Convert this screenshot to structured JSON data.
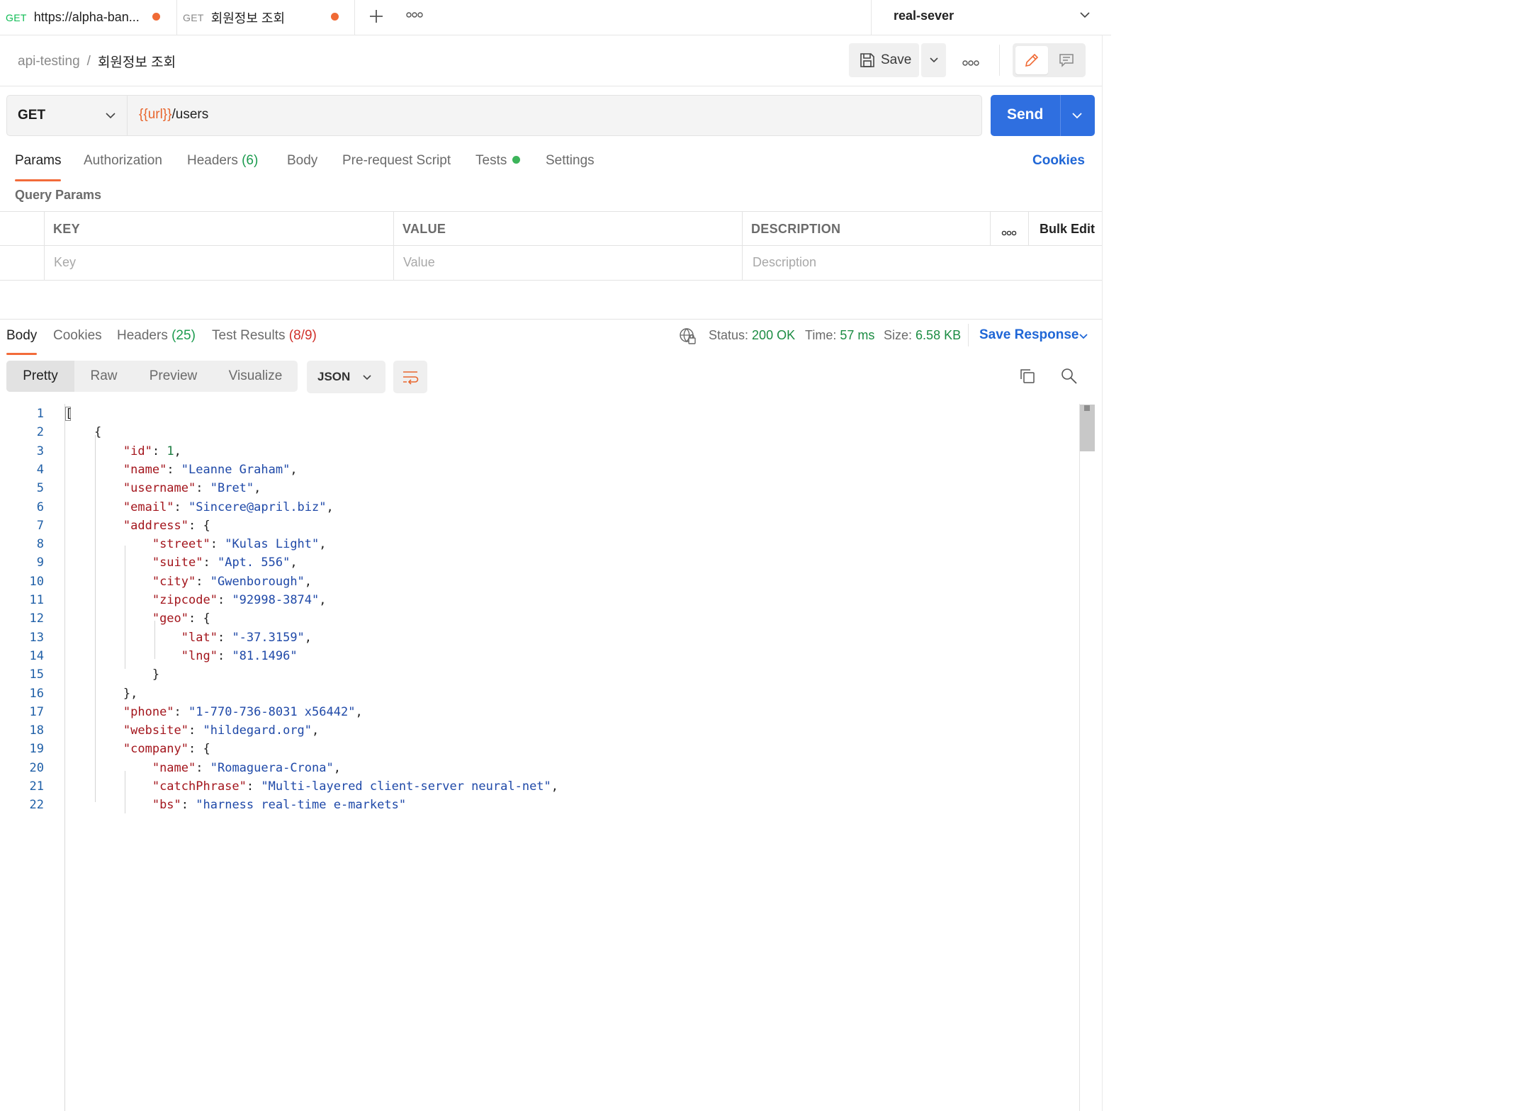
{
  "tabs": [
    {
      "method": "GET",
      "title": "https://alpha-ban..."
    },
    {
      "method": "GET",
      "title": "회원정보 조회"
    }
  ],
  "environment": {
    "name": "real-sever"
  },
  "breadcrumb": {
    "collection": "api-testing",
    "separator": "/",
    "request": "회원정보 조회"
  },
  "toolbar": {
    "save_label": "Save"
  },
  "request": {
    "method": "GET",
    "url_variable": "{{url}}",
    "url_path": "/users",
    "send_label": "Send"
  },
  "request_tabs": {
    "params": "Params",
    "authorization": "Authorization",
    "headers": "Headers",
    "headers_count": "(6)",
    "body": "Body",
    "prerequest": "Pre-request Script",
    "tests": "Tests",
    "settings": "Settings",
    "cookies": "Cookies"
  },
  "query_params": {
    "title": "Query Params",
    "columns": [
      "KEY",
      "VALUE",
      "DESCRIPTION"
    ],
    "bulk_edit": "Bulk Edit",
    "placeholders": {
      "key": "Key",
      "value": "Value",
      "description": "Description"
    }
  },
  "response": {
    "tabs": {
      "body": "Body",
      "cookies": "Cookies",
      "headers": "Headers",
      "headers_count": "(25)",
      "test_results": "Test Results",
      "test_results_count": "(8/9)"
    },
    "status_label": "Status:",
    "status_value": "200 OK",
    "time_label": "Time:",
    "time_value": "57 ms",
    "size_label": "Size:",
    "size_value": "6.58 KB",
    "save_response": "Save Response",
    "formats": [
      "Pretty",
      "Raw",
      "Preview",
      "Visualize"
    ],
    "language": "JSON"
  },
  "code_lines": [
    [
      [
        "p",
        "["
      ]
    ],
    [
      [
        "p",
        "    {"
      ]
    ],
    [
      [
        "p",
        "        "
      ],
      [
        "k",
        "\"id\""
      ],
      [
        "p",
        ": "
      ],
      [
        "n",
        "1"
      ],
      [
        "p",
        ","
      ]
    ],
    [
      [
        "p",
        "        "
      ],
      [
        "k",
        "\"name\""
      ],
      [
        "p",
        ": "
      ],
      [
        "s",
        "\"Leanne Graham\""
      ],
      [
        "p",
        ","
      ]
    ],
    [
      [
        "p",
        "        "
      ],
      [
        "k",
        "\"username\""
      ],
      [
        "p",
        ": "
      ],
      [
        "s",
        "\"Bret\""
      ],
      [
        "p",
        ","
      ]
    ],
    [
      [
        "p",
        "        "
      ],
      [
        "k",
        "\"email\""
      ],
      [
        "p",
        ": "
      ],
      [
        "s",
        "\"Sincere@april.biz\""
      ],
      [
        "p",
        ","
      ]
    ],
    [
      [
        "p",
        "        "
      ],
      [
        "k",
        "\"address\""
      ],
      [
        "p",
        ": {"
      ]
    ],
    [
      [
        "p",
        "            "
      ],
      [
        "k",
        "\"street\""
      ],
      [
        "p",
        ": "
      ],
      [
        "s",
        "\"Kulas Light\""
      ],
      [
        "p",
        ","
      ]
    ],
    [
      [
        "p",
        "            "
      ],
      [
        "k",
        "\"suite\""
      ],
      [
        "p",
        ": "
      ],
      [
        "s",
        "\"Apt. 556\""
      ],
      [
        "p",
        ","
      ]
    ],
    [
      [
        "p",
        "            "
      ],
      [
        "k",
        "\"city\""
      ],
      [
        "p",
        ": "
      ],
      [
        "s",
        "\"Gwenborough\""
      ],
      [
        "p",
        ","
      ]
    ],
    [
      [
        "p",
        "            "
      ],
      [
        "k",
        "\"zipcode\""
      ],
      [
        "p",
        ": "
      ],
      [
        "s",
        "\"92998-3874\""
      ],
      [
        "p",
        ","
      ]
    ],
    [
      [
        "p",
        "            "
      ],
      [
        "k",
        "\"geo\""
      ],
      [
        "p",
        ": {"
      ]
    ],
    [
      [
        "p",
        "                "
      ],
      [
        "k",
        "\"lat\""
      ],
      [
        "p",
        ": "
      ],
      [
        "s",
        "\"-37.3159\""
      ],
      [
        "p",
        ","
      ]
    ],
    [
      [
        "p",
        "                "
      ],
      [
        "k",
        "\"lng\""
      ],
      [
        "p",
        ": "
      ],
      [
        "s",
        "\"81.1496\""
      ]
    ],
    [
      [
        "p",
        "            }"
      ]
    ],
    [
      [
        "p",
        "        },"
      ]
    ],
    [
      [
        "p",
        "        "
      ],
      [
        "k",
        "\"phone\""
      ],
      [
        "p",
        ": "
      ],
      [
        "s",
        "\"1-770-736-8031 x56442\""
      ],
      [
        "p",
        ","
      ]
    ],
    [
      [
        "p",
        "        "
      ],
      [
        "k",
        "\"website\""
      ],
      [
        "p",
        ": "
      ],
      [
        "s",
        "\"hildegard.org\""
      ],
      [
        "p",
        ","
      ]
    ],
    [
      [
        "p",
        "        "
      ],
      [
        "k",
        "\"company\""
      ],
      [
        "p",
        ": {"
      ]
    ],
    [
      [
        "p",
        "            "
      ],
      [
        "k",
        "\"name\""
      ],
      [
        "p",
        ": "
      ],
      [
        "s",
        "\"Romaguera-Crona\""
      ],
      [
        "p",
        ","
      ]
    ],
    [
      [
        "p",
        "            "
      ],
      [
        "k",
        "\"catchPhrase\""
      ],
      [
        "p",
        ": "
      ],
      [
        "s",
        "\"Multi-layered client-server neural-net\""
      ],
      [
        "p",
        ","
      ]
    ],
    [
      [
        "p",
        "            "
      ],
      [
        "k",
        "\"bs\""
      ],
      [
        "p",
        ": "
      ],
      [
        "s",
        "\"harness real-time e-markets\""
      ]
    ]
  ],
  "colors": {
    "accent": "#f26b3a",
    "send": "#2f6fe0",
    "link": "#1f66d6",
    "status_ok": "#1c8c43",
    "json_key": "#a3151c",
    "json_string": "#1f49a8",
    "json_number": "#1b7c3f"
  },
  "icons": [
    "close-unsaved-dot",
    "plus-icon",
    "more-icon",
    "chevron-down-icon",
    "save-icon",
    "pencil-icon",
    "comment-icon",
    "globe-lock-icon",
    "wrap-icon",
    "copy-icon",
    "search-icon"
  ]
}
